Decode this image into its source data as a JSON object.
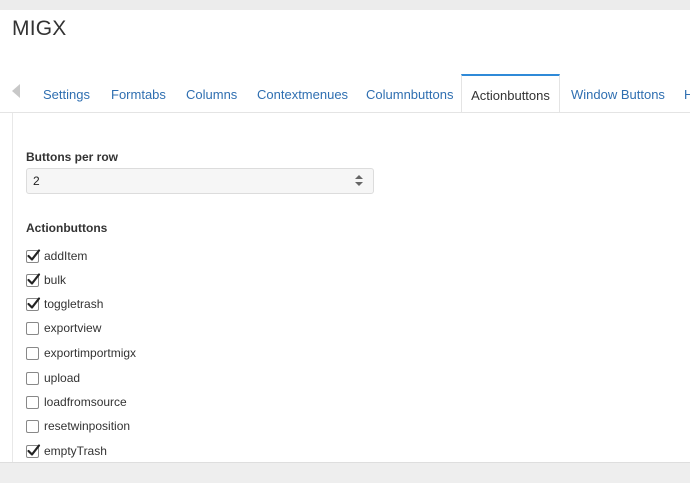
{
  "window": {
    "title": "MIGX"
  },
  "tabs": [
    {
      "label": "Settings",
      "active": false
    },
    {
      "label": "Formtabs",
      "active": false
    },
    {
      "label": "Columns",
      "active": false
    },
    {
      "label": "Contextmenues",
      "active": false
    },
    {
      "label": "Columnbuttons",
      "active": false
    },
    {
      "label": "Actionbuttons",
      "active": true
    },
    {
      "label": "Window Buttons",
      "active": false
    },
    {
      "label": "H",
      "active": false
    }
  ],
  "buttons_per_row": {
    "label": "Buttons per row",
    "value": "2"
  },
  "actionbuttons": {
    "label": "Actionbuttons",
    "items": [
      {
        "label": "addItem",
        "checked": true
      },
      {
        "label": "bulk",
        "checked": true
      },
      {
        "label": "toggletrash",
        "checked": true
      },
      {
        "label": "exportview",
        "checked": false
      },
      {
        "label": "exportimportmigx",
        "checked": false
      },
      {
        "label": "upload",
        "checked": false
      },
      {
        "label": "loadfromsource",
        "checked": false
      },
      {
        "label": "resetwinposition",
        "checked": false
      },
      {
        "label": "emptyTrash",
        "checked": true
      }
    ]
  },
  "colors": {
    "accent": "#2f8ad8",
    "link": "#2f6fb1"
  }
}
